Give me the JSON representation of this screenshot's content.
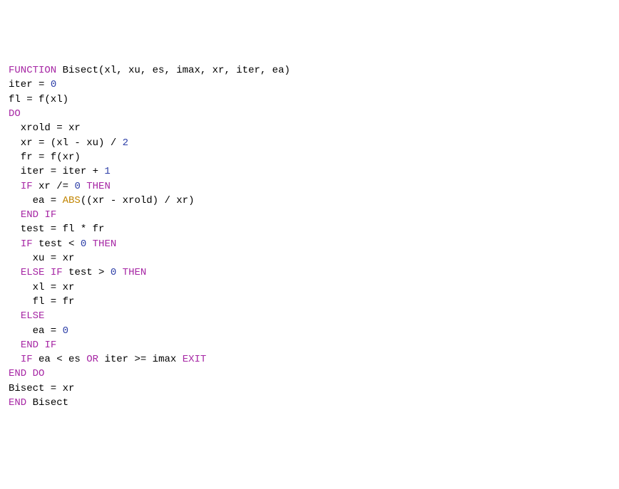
{
  "code": {
    "l1": {
      "kw1": "FUNCTION",
      "rest": " Bisect(xl, xu, es, imax, xr, iter, ea)"
    },
    "l2": {
      "a": "iter = ",
      "n": "0"
    },
    "l3": {
      "a": "fl = f(xl)"
    },
    "l4": {
      "kw": "DO"
    },
    "l5": {
      "a": "  xrold = xr"
    },
    "l6": {
      "a": "  xr = (xl - xu) / ",
      "n": "2"
    },
    "l7": {
      "a": "  fr = f(xr)"
    },
    "l8": {
      "a": "  iter = iter + ",
      "n": "1"
    },
    "l9": {
      "sp": "  ",
      "kw1": "IF",
      "mid": " xr /= ",
      "n": "0",
      "sp2": " ",
      "kw2": "THEN"
    },
    "l10": {
      "a": "    ea = ",
      "fn": "ABS",
      "b": "((xr - xrold) / xr)"
    },
    "l11": {
      "sp": "  ",
      "kw1": "END",
      "sp2": " ",
      "kw2": "IF"
    },
    "l12": {
      "a": "  test = fl * fr"
    },
    "l13": {
      "sp": "  ",
      "kw1": "IF",
      "mid": " test < ",
      "n": "0",
      "sp2": " ",
      "kw2": "THEN"
    },
    "l14": {
      "a": "    xu = xr"
    },
    "l15": {
      "sp": "  ",
      "kw1": "ELSE",
      "sp2": " ",
      "kw2": "IF",
      "mid": " test > ",
      "n": "0",
      "sp3": " ",
      "kw3": "THEN"
    },
    "l16": {
      "a": "    xl = xr"
    },
    "l17": {
      "a": "    fl = fr"
    },
    "l18": {
      "sp": "  ",
      "kw": "ELSE"
    },
    "l19": {
      "a": "    ea = ",
      "n": "0"
    },
    "l20": {
      "sp": "  ",
      "kw1": "END",
      "sp2": " ",
      "kw2": "IF"
    },
    "l21": {
      "sp": "  ",
      "kw1": "IF",
      "mid1": " ea < es ",
      "kw2": "OR",
      "mid2": " iter >= imax ",
      "kw3": "EXIT"
    },
    "l22": {
      "kw1": "END",
      "sp": " ",
      "kw2": "DO"
    },
    "l23": {
      "a": "Bisect = xr"
    },
    "l24": {
      "kw": "END",
      "rest": " Bisect"
    }
  }
}
